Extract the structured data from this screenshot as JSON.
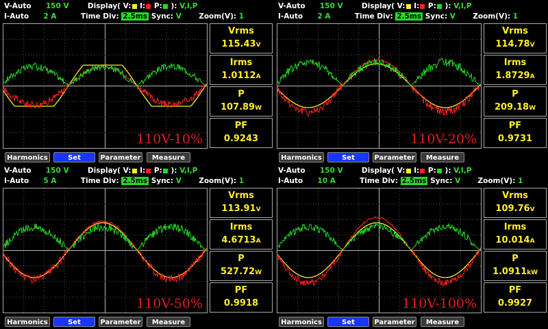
{
  "colors": {
    "voltage": "#ffef27",
    "current": "#ff2020",
    "power": "#22dd22",
    "button_selected": "#1a35ff"
  },
  "panels": [
    {
      "v_range_label": "V-Auto",
      "v_range": "150 V",
      "i_range_label": "I-Auto",
      "i_range": "2 A",
      "display_label": "Display( V:",
      "display_i": " I:",
      "display_p": " P:",
      "display_end": " ):",
      "display_mode": "V,I,P",
      "time_div_label": "Time  Div:",
      "time_div": "2.5ms",
      "sync_label": "Sync:",
      "sync": "V",
      "zoom_label": "Zoom(V):",
      "zoom": "1",
      "label": "110V-10%",
      "vrms_label": "Vrms",
      "vrms": "115.43",
      "vrms_unit": "V",
      "irms_label": "Irms",
      "irms": "1.0112",
      "irms_unit": "A",
      "p_label": "P",
      "p": "107.89",
      "p_unit": "W",
      "pf_label": "PF",
      "pf": "0.9243",
      "buttons": [
        "Harmonics",
        "Set",
        "Parameter",
        "Measure"
      ]
    },
    {
      "v_range_label": "V-Auto",
      "v_range": "150 V",
      "i_range_label": "I-Auto",
      "i_range": "2 A",
      "display_label": "Display( V:",
      "display_i": " I:",
      "display_p": " P:",
      "display_end": " ):",
      "display_mode": "V,I,P",
      "time_div_label": "Time  Div:",
      "time_div": "2.5ms",
      "sync_label": "Sync:",
      "sync": "V",
      "zoom_label": "Zoom(V):",
      "zoom": "1",
      "label": "110V-20%",
      "vrms_label": "Vrms",
      "vrms": "114.78",
      "vrms_unit": "V",
      "irms_label": "Irms",
      "irms": "1.8729",
      "irms_unit": "A",
      "p_label": "P",
      "p": "209.18",
      "p_unit": "W",
      "pf_label": "PF",
      "pf": "0.9731",
      "buttons": [
        "Harmonics",
        "Set",
        "Parameter",
        "Measure"
      ]
    },
    {
      "v_range_label": "V-Auto",
      "v_range": "150 V",
      "i_range_label": "I-Auto",
      "i_range": "5 A",
      "display_label": "Display( V:",
      "display_i": " I:",
      "display_p": " P:",
      "display_end": " ):",
      "display_mode": "V,I,P",
      "time_div_label": "Time  Div:",
      "time_div": "2.5ms",
      "sync_label": "Sync:",
      "sync": "V",
      "zoom_label": "Zoom(V):",
      "zoom": "1",
      "label": "110V-50%",
      "vrms_label": "Vrms",
      "vrms": "113.91",
      "vrms_unit": "V",
      "irms_label": "Irms",
      "irms": "4.6713",
      "irms_unit": "A",
      "p_label": "P",
      "p": "527.72",
      "p_unit": "W",
      "pf_label": "PF",
      "pf": "0.9918",
      "buttons": [
        "Harmonics",
        "Set",
        "Parameter",
        "Measure"
      ]
    },
    {
      "v_range_label": "V-Auto",
      "v_range": "150 V",
      "i_range_label": "I-Auto",
      "i_range": "10 A",
      "display_label": "Display( V:",
      "display_i": " I:",
      "display_p": " P:",
      "display_end": " ):",
      "display_mode": "V,I,P",
      "time_div_label": "Time  Div:",
      "time_div": "2.5ms",
      "sync_label": "Sync:",
      "sync": "V",
      "zoom_label": "Zoom(V):",
      "zoom": "1",
      "label": "110V-100%",
      "vrms_label": "Vrms",
      "vrms": "109.76",
      "vrms_unit": "V",
      "irms_label": "Irms",
      "irms": "10.014",
      "irms_unit": "A",
      "p_label": "P",
      "p": "1.0911",
      "p_unit": "kW",
      "pf_label": "PF",
      "pf": "0.9927",
      "buttons": [
        "Harmonics",
        "Set",
        "Parameter",
        "Measure"
      ]
    }
  ]
}
